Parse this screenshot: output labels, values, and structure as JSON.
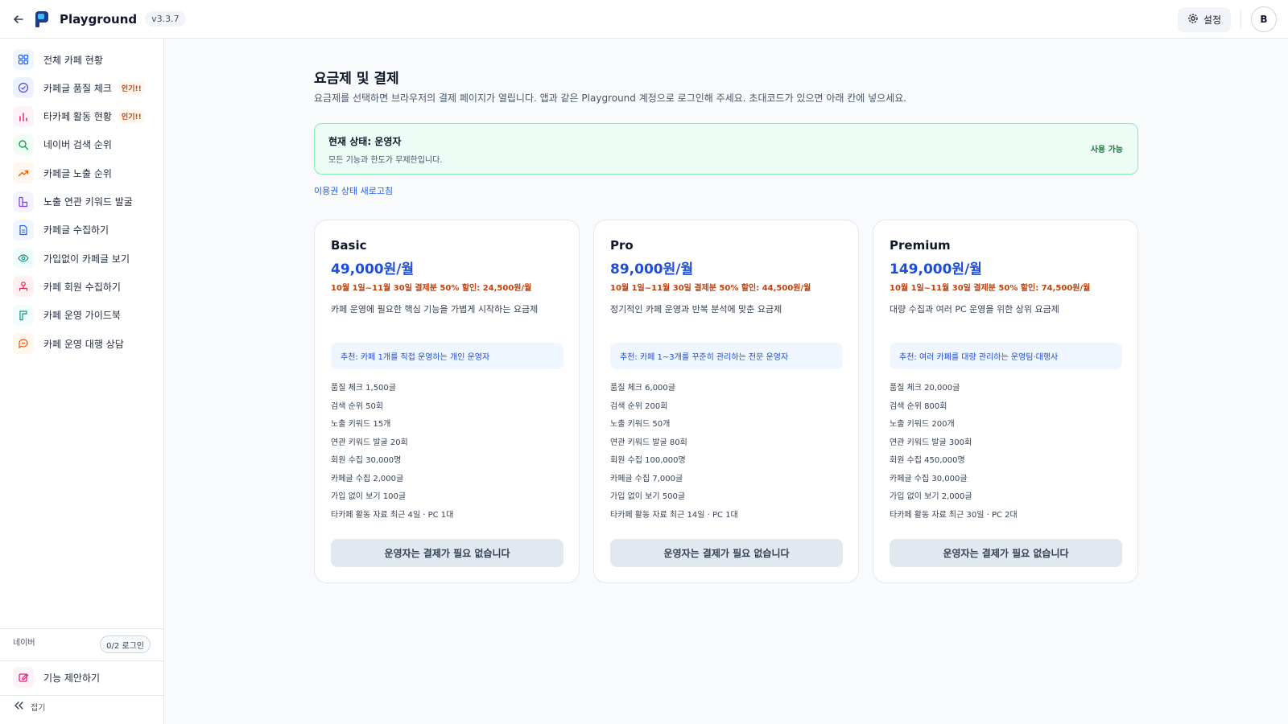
{
  "header": {
    "app_title": "Playground",
    "version": "v3.3.7",
    "settings_label": "설정",
    "avatar_initial": "B"
  },
  "sidebar": {
    "items": [
      {
        "label": "전체 카페 현황",
        "icon": "grid-icon",
        "color": "#2563eb",
        "bg": "#eff6ff",
        "badge": ""
      },
      {
        "label": "카페글 품질 체크",
        "icon": "check-circle-icon",
        "color": "#4f46e5",
        "bg": "#eef2ff",
        "badge": "인기!!"
      },
      {
        "label": "타카페 활동 현황",
        "icon": "bar-chart-icon",
        "color": "#db2777",
        "bg": "#fdf2f8",
        "badge": "인기!!"
      },
      {
        "label": "네이버 검색 순위",
        "icon": "search-icon",
        "color": "#16a34a",
        "bg": "#f0fdf4",
        "badge": ""
      },
      {
        "label": "카페글 노출 순위",
        "icon": "trending-up-icon",
        "color": "#ea580c",
        "bg": "#fff7ed",
        "badge": ""
      },
      {
        "label": "노출 연관 키워드 발굴",
        "icon": "tag-icon",
        "color": "#7c3aed",
        "bg": "#f5f3ff",
        "badge": ""
      },
      {
        "label": "카페글 수집하기",
        "icon": "document-icon",
        "color": "#2563eb",
        "bg": "#eff6ff",
        "badge": ""
      },
      {
        "label": "가입없이 카페글 보기",
        "icon": "eye-icon",
        "color": "#0d9488",
        "bg": "#f0fdfa",
        "badge": ""
      },
      {
        "label": "카페 회원 수집하기",
        "icon": "users-icon",
        "color": "#e11d48",
        "bg": "#fff1f2",
        "badge": ""
      },
      {
        "label": "카페 운영 가이드북",
        "icon": "book-icon",
        "color": "#0d9488",
        "bg": "#f0fdfa",
        "badge": ""
      },
      {
        "label": "카페 운영 대행 상담",
        "icon": "chat-icon",
        "color": "#ea580c",
        "bg": "#fff7ed",
        "badge": ""
      }
    ],
    "naver_label": "네이버",
    "login_status": "0/2 로그인",
    "suggest_label": "기능 제안하기",
    "collapse_label": "접기"
  },
  "main": {
    "title": "요금제 및 결제",
    "description": "요금제를 선택하면 브라우저의 결제 페이지가 열립니다. 앱과 같은 Playground 계정으로 로그인해 주세요. 초대코드가 있으면 아래 칸에 넣으세요.",
    "status": {
      "title": "현재 상태: 운영자",
      "description": "모든 기능과 한도가 무제한입니다.",
      "chip": "사용 가능"
    },
    "refresh_link": "이용권 상태 새로고침",
    "plans": [
      {
        "name": "Basic",
        "price": "49,000원/월",
        "promo": "10월 1일~11월 30일 결제분 50% 할인: 24,500원/월",
        "description": "카페 운영에 필요한 핵심 기능을 가볍게 시작하는 요금제",
        "recommend": "추천: 카페 1개를 직접 운영하는 개인 운영자",
        "features": [
          "품질 체크 1,500글",
          "검색 순위 50회",
          "노출 키워드 15개",
          "연관 키워드 발굴 20회",
          "회원 수집 30,000명",
          "카페글 수집 2,000글",
          "가입 없이 보기 100글",
          "타카페 활동 자료 최근 4일 · PC 1대"
        ],
        "button": "운영자는 결제가 필요 없습니다"
      },
      {
        "name": "Pro",
        "price": "89,000원/월",
        "promo": "10월 1일~11월 30일 결제분 50% 할인: 44,500원/월",
        "description": "정기적인 카페 운영과 반복 분석에 맞춘 요금제",
        "recommend": "추천: 카페 1~3개를 꾸준히 관리하는 전문 운영자",
        "features": [
          "품질 체크 6,000글",
          "검색 순위 200회",
          "노출 키워드 50개",
          "연관 키워드 발굴 80회",
          "회원 수집 100,000명",
          "카페글 수집 7,000글",
          "가입 없이 보기 500글",
          "타카페 활동 자료 최근 14일 · PC 1대"
        ],
        "button": "운영자는 결제가 필요 없습니다"
      },
      {
        "name": "Premium",
        "price": "149,000원/월",
        "promo": "10월 1일~11월 30일 결제분 50% 할인: 74,500원/월",
        "description": "대량 수집과 여러 PC 운영을 위한 상위 요금제",
        "recommend": "추천: 여러 카페를 대량 관리하는 운영팀·대행사",
        "features": [
          "품질 체크 20,000글",
          "검색 순위 800회",
          "노출 키워드 200개",
          "연관 키워드 발굴 300회",
          "회원 수집 450,000명",
          "카페글 수집 30,000글",
          "가입 없이 보기 2,000글",
          "타카페 활동 자료 최근 30일 · PC 2대"
        ],
        "button": "운영자는 결제가 필요 없습니다"
      }
    ]
  }
}
